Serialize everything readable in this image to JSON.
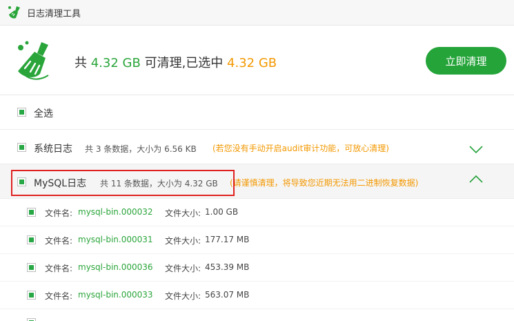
{
  "window": {
    "title": "日志清理工具"
  },
  "header": {
    "summary_prefix": "共",
    "total_size": "4.32 GB",
    "summary_middle": "可清理,已选中",
    "selected_size": "4.32 GB",
    "clean_button": "立即清理"
  },
  "select_all": {
    "label": "全选"
  },
  "groups": {
    "system": {
      "name": "系统日志",
      "info": "共 3 条数据，大小为 6.56 KB",
      "note": "(若您没有手动开启audit审计功能，可放心清理)"
    },
    "mysql": {
      "name": "MySQL日志",
      "info": "共 11 条数据，大小为 4.32 GB",
      "note": "(请谨慎清理，将导致您近期无法用二进制恢复数据)"
    }
  },
  "file_labels": {
    "name": "文件名:",
    "size": "文件大小:"
  },
  "files": [
    {
      "name": "mysql-bin.000032",
      "size": "1.00 GB"
    },
    {
      "name": "mysql-bin.000031",
      "size": "177.17 MB"
    },
    {
      "name": "mysql-bin.000036",
      "size": "453.39 MB"
    },
    {
      "name": "mysql-bin.000033",
      "size": "563.07 MB"
    }
  ],
  "colors": {
    "accent": "#25a43a",
    "highlight": "#f39800",
    "annotation": "#e02020"
  }
}
